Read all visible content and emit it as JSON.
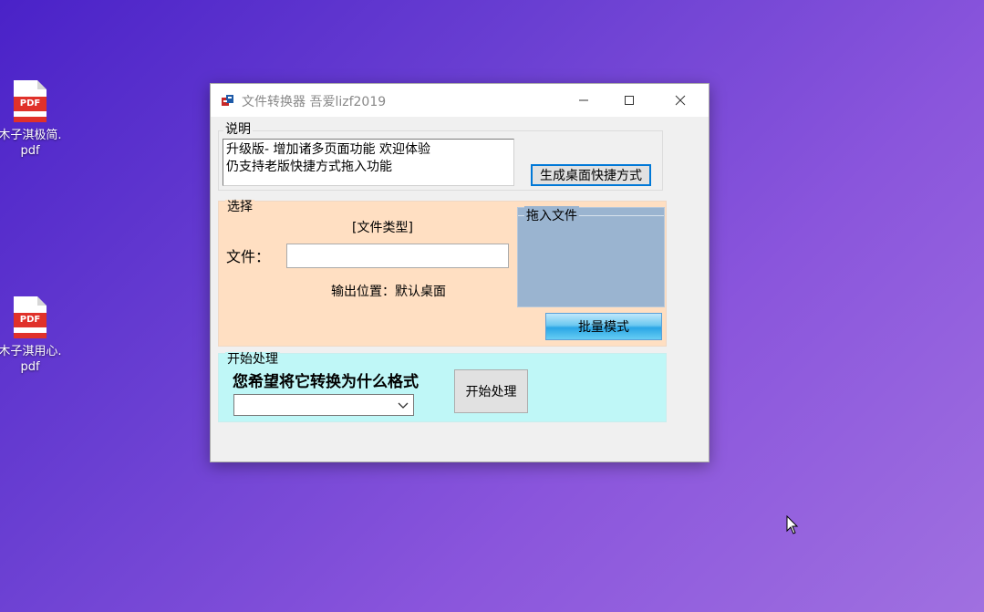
{
  "desktop": {
    "icons": [
      {
        "label_line1": "木子淇极简.",
        "label_line2": "pdf",
        "badge": "PDF"
      },
      {
        "label_line1": "木子淇用心.",
        "label_line2": "pdf",
        "badge": "PDF"
      }
    ]
  },
  "window": {
    "title": "文件转换器 吾爱lizf2019",
    "controls": {
      "minimize": "minimize-icon",
      "maximize": "maximize-icon",
      "close": "close-icon"
    },
    "description_group": {
      "title": "说明",
      "text_line1": "升级版- 增加诸多页面功能 欢迎体验",
      "text_line2": "仍支持老版快捷方式拖入功能",
      "shortcut_button": "生成桌面快捷方式"
    },
    "select_group": {
      "title": "选择",
      "file_type": "[文件类型]",
      "file_label": "文件：",
      "file_value": "",
      "output_location": "输出位置：默认桌面",
      "drop_box_title": "拖入文件",
      "batch_button": "批量模式"
    },
    "process_group": {
      "title": "开始处理",
      "question": "您希望将它转换为什么格式",
      "format_selected": "",
      "start_button": "开始处理"
    }
  },
  "colors": {
    "select_group_bg": "#ffdfc2",
    "process_group_bg": "#bff7f7",
    "drop_box_bg": "#9ab4d0",
    "focus_border": "#0078d7"
  }
}
